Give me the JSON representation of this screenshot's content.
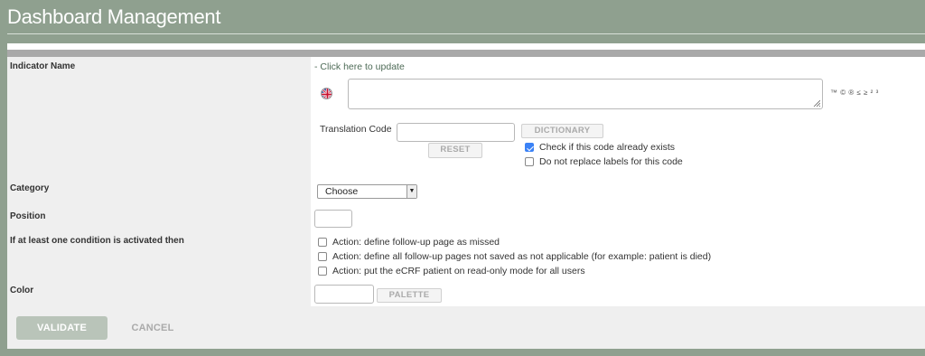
{
  "header": {
    "title": "Dashboard Management"
  },
  "form": {
    "indicator_name": {
      "label": "Indicator Name",
      "update_link": "- Click here to update",
      "flag_icon": "uk-flag-icon",
      "textarea_value": "",
      "special_chars": "™ © ® ≤ ≥ ² ³"
    },
    "translation": {
      "label": "Translation Code",
      "value": "",
      "dictionary_label": "DICTIONARY",
      "reset_label": "RESET",
      "check_exists": {
        "label": "Check if this code already exists",
        "checked": true
      },
      "no_replace": {
        "label": "Do not replace labels for this code",
        "checked": false
      }
    },
    "category": {
      "label": "Category",
      "selected": "Choose"
    },
    "position": {
      "label": "Position",
      "value": ""
    },
    "condition": {
      "label": "If at least one condition is activated then",
      "actions": [
        {
          "label": "Action: define follow-up page as missed",
          "checked": false
        },
        {
          "label": "Action: define all follow-up pages not saved as not applicable (for example: patient is died)",
          "checked": false
        },
        {
          "label": "Action: put the eCRF patient on read-only mode for all users",
          "checked": false
        }
      ]
    },
    "color": {
      "label": "Color",
      "value": "",
      "palette_label": "PALETTE"
    }
  },
  "footer": {
    "validate_label": "VALIDATE",
    "cancel_label": "CANCEL"
  },
  "colors": {
    "header_bg": "#8fa08f",
    "link": "#4e6b57",
    "validate_bg": "#b9c4b9",
    "checkbox_checked": "#3b82f6"
  }
}
